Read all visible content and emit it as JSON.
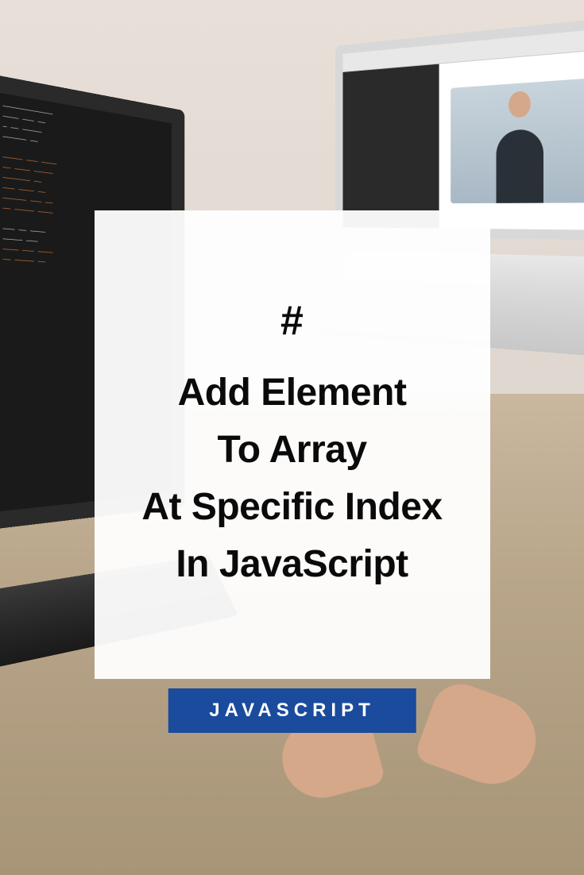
{
  "card": {
    "hash": "#",
    "line1": "Add Element",
    "line2": "To Array",
    "line3": "At Specific Index",
    "line4": "In JavaScript"
  },
  "badge": {
    "label": "JAVASCRIPT"
  },
  "colors": {
    "badge_bg": "#1a4b9c",
    "badge_text": "#ffffff",
    "card_bg": "rgba(255, 255, 255, 0.95)",
    "title_color": "#0a0a0a"
  }
}
